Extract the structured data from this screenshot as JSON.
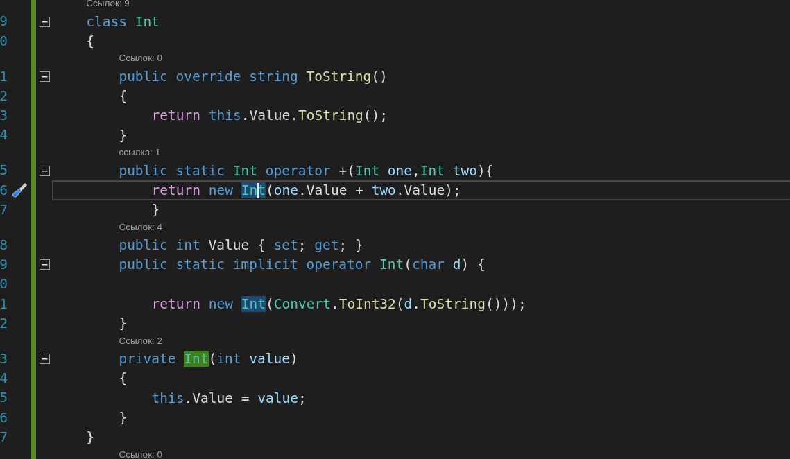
{
  "editor": {
    "rows": [
      {
        "kind": "lens",
        "changed": true,
        "text": "Ссылок: 9"
      },
      {
        "kind": "code",
        "changed": true,
        "number": "9",
        "fold": true,
        "current": false,
        "tool": false,
        "tokens": [
          {
            "text": "class ",
            "kind": "keyword"
          },
          {
            "text": "Int",
            "kind": "type"
          }
        ]
      },
      {
        "kind": "code",
        "changed": true,
        "number": "0",
        "fold": false,
        "current": false,
        "tool": false,
        "tokens": [
          {
            "text": "{",
            "kind": "plain"
          }
        ],
        "children": [
          {
            "kind": "lens",
            "changed": true,
            "text": "Ссылок: 0"
          },
          {
            "kind": "code",
            "changed": true,
            "number": "1",
            "fold": true,
            "current": false,
            "tool": false,
            "tokens": [
              {
                "text": "public override string ",
                "kind": "keyword"
              },
              {
                "text": "ToString",
                "kind": "method"
              },
              {
                "text": "()",
                "kind": "plain"
              }
            ]
          },
          {
            "kind": "code",
            "changed": true,
            "number": "2",
            "fold": false,
            "current": false,
            "tool": false,
            "tokens": [
              {
                "text": "{",
                "kind": "plain"
              }
            ],
            "children": [
              {
                "kind": "code",
                "changed": true,
                "number": "3",
                "fold": false,
                "current": false,
                "tool": false,
                "tokens": [
                  {
                    "text": "return ",
                    "kind": "control"
                  },
                  {
                    "text": "this",
                    "kind": "keyword"
                  },
                  {
                    "text": ".Value.",
                    "kind": "plain"
                  },
                  {
                    "text": "ToString",
                    "kind": "method"
                  },
                  {
                    "text": "();",
                    "kind": "plain"
                  }
                ]
              }
            ]
          },
          {
            "kind": "code",
            "changed": true,
            "number": "4",
            "fold": false,
            "current": false,
            "tool": false,
            "tokens": [
              {
                "text": "}",
                "kind": "plain"
              }
            ]
          },
          {
            "kind": "lens",
            "changed": true,
            "text": "ссылка: 1"
          },
          {
            "kind": "code",
            "changed": true,
            "number": "5",
            "fold": true,
            "current": false,
            "tool": false,
            "tokens": [
              {
                "text": "public static ",
                "kind": "keyword"
              },
              {
                "text": "Int ",
                "kind": "type"
              },
              {
                "text": "operator ",
                "kind": "keyword"
              },
              {
                "text": "+(",
                "kind": "plain"
              },
              {
                "text": "Int ",
                "kind": "type"
              },
              {
                "text": "one",
                "kind": "param"
              },
              {
                "text": ",",
                "kind": "plain"
              },
              {
                "text": "Int ",
                "kind": "type"
              },
              {
                "text": "two",
                "kind": "param"
              },
              {
                "text": "){",
                "kind": "plain"
              }
            ],
            "children": [
              {
                "kind": "code",
                "changed": true,
                "number": "6",
                "fold": false,
                "current": true,
                "tool": true,
                "tokens": [
                  {
                    "text": "return ",
                    "kind": "control"
                  },
                  {
                    "text": "new ",
                    "kind": "keyword"
                  },
                  {
                    "text": "In",
                    "kind": "type",
                    "color": "#1f4a78"
                  },
                  {
                    "text": "t",
                    "kind": "type",
                    "color": "#1f4a78",
                    "caret": true
                  },
                  {
                    "text": "(",
                    "kind": "plain"
                  },
                  {
                    "text": "one",
                    "kind": "param"
                  },
                  {
                    "text": ".Value + ",
                    "kind": "plain"
                  },
                  {
                    "text": "two",
                    "kind": "param"
                  },
                  {
                    "text": ".Value);",
                    "kind": "plain"
                  }
                ]
              },
              {
                "kind": "code",
                "changed": true,
                "number": "7",
                "fold": false,
                "current": false,
                "tool": false,
                "tokens": [
                  {
                    "text": "}",
                    "kind": "plain"
                  }
                ]
              }
            ]
          },
          {
            "kind": "lens",
            "changed": true,
            "text": "Ссылок: 4"
          },
          {
            "kind": "code",
            "changed": true,
            "number": "8",
            "fold": false,
            "current": false,
            "tool": false,
            "tokens": [
              {
                "text": "public int",
                "kind": "keyword"
              },
              {
                "text": " Value { ",
                "kind": "plain"
              },
              {
                "text": "set",
                "kind": "keyword"
              },
              {
                "text": "; ",
                "kind": "plain"
              },
              {
                "text": "get",
                "kind": "keyword"
              },
              {
                "text": "; }",
                "kind": "plain"
              }
            ]
          },
          {
            "kind": "code",
            "changed": true,
            "number": "9",
            "fold": true,
            "current": false,
            "tool": false,
            "tokens": [
              {
                "text": "public static implicit operator ",
                "kind": "keyword"
              },
              {
                "text": "Int",
                "kind": "type"
              },
              {
                "text": "(",
                "kind": "plain"
              },
              {
                "text": "char ",
                "kind": "keyword"
              },
              {
                "text": "d",
                "kind": "param"
              },
              {
                "text": ") {",
                "kind": "plain"
              }
            ],
            "children": [
              {
                "kind": "code",
                "changed": true,
                "number": "0",
                "fold": false,
                "current": false,
                "tool": false
              },
              {
                "kind": "code",
                "changed": true,
                "number": "1",
                "fold": false,
                "current": false,
                "tool": false,
                "tokens": [
                  {
                    "text": "return ",
                    "kind": "control"
                  },
                  {
                    "text": "new ",
                    "kind": "keyword"
                  },
                  {
                    "text": "Int",
                    "kind": "type",
                    "color": "#1f4a78"
                  },
                  {
                    "text": "(",
                    "kind": "plain"
                  },
                  {
                    "text": "Convert",
                    "kind": "type"
                  },
                  {
                    "text": ".",
                    "kind": "plain"
                  },
                  {
                    "text": "ToInt32",
                    "kind": "method"
                  },
                  {
                    "text": "(",
                    "kind": "plain"
                  },
                  {
                    "text": "d",
                    "kind": "param"
                  },
                  {
                    "text": ".",
                    "kind": "plain"
                  },
                  {
                    "text": "ToString",
                    "kind": "method"
                  },
                  {
                    "text": "()));",
                    "kind": "plain"
                  }
                ]
              }
            ]
          },
          {
            "kind": "code",
            "changed": true,
            "number": "2",
            "fold": false,
            "current": false,
            "tool": false,
            "tokens": [
              {
                "text": "}",
                "kind": "plain"
              }
            ]
          },
          {
            "kind": "lens",
            "changed": true,
            "text": "Ссылок: 2"
          },
          {
            "kind": "code",
            "changed": true,
            "number": "3",
            "fold": true,
            "current": false,
            "tool": false,
            "tokens": [
              {
                "text": "private ",
                "kind": "keyword"
              },
              {
                "text": "Int",
                "kind": "type",
                "color": "#41801c"
              },
              {
                "text": "(",
                "kind": "plain"
              },
              {
                "text": "int ",
                "kind": "keyword"
              },
              {
                "text": "value",
                "kind": "param"
              },
              {
                "text": ")",
                "kind": "plain"
              }
            ]
          },
          {
            "kind": "code",
            "changed": true,
            "number": "4",
            "fold": false,
            "current": false,
            "tool": false,
            "tokens": [
              {
                "text": "{",
                "kind": "plain"
              }
            ],
            "children": [
              {
                "kind": "code",
                "changed": true,
                "number": "5",
                "fold": false,
                "current": false,
                "tool": false,
                "tokens": [
                  {
                    "text": "this",
                    "kind": "keyword"
                  },
                  {
                    "text": ".Value = ",
                    "kind": "plain"
                  },
                  {
                    "text": "value",
                    "kind": "param"
                  },
                  {
                    "text": ";",
                    "kind": "plain"
                  }
                ]
              }
            ]
          },
          {
            "kind": "code",
            "changed": true,
            "number": "6",
            "fold": false,
            "current": false,
            "tool": false,
            "tokens": [
              {
                "text": "}",
                "kind": "plain"
              }
            ]
          }
        ]
      },
      {
        "kind": "code",
        "changed": true,
        "number": "7",
        "fold": false,
        "current": false,
        "tool": false,
        "tokens": [
          {
            "text": "}",
            "kind": "plain"
          }
        ],
        "children": [
          {
            "kind": "lens",
            "changed": true,
            "text": "Ссылок: 0"
          }
        ]
      }
    ]
  }
}
